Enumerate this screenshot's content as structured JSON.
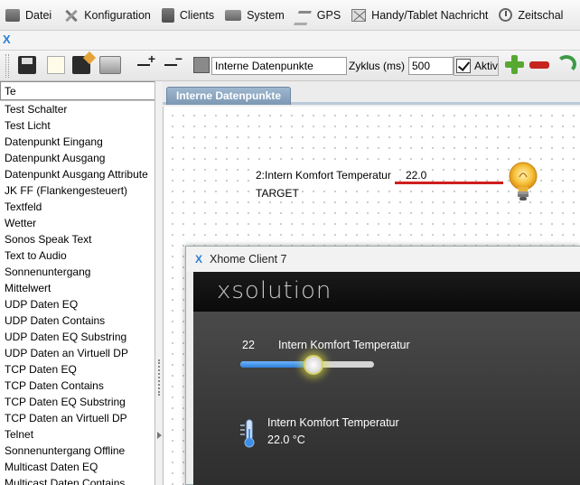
{
  "menu": {
    "items": [
      {
        "label": "Datei",
        "icon": "datei-icon"
      },
      {
        "label": "Konfiguration",
        "icon": "tools-icon"
      },
      {
        "label": "Clients",
        "icon": "clients-icon"
      },
      {
        "label": "System",
        "icon": "system-icon"
      },
      {
        "label": "GPS",
        "icon": "gps-icon"
      },
      {
        "label": "Handy/Tablet Nachricht",
        "icon": "message-icon"
      },
      {
        "label": "Zeitschal",
        "icon": "clock-icon"
      }
    ]
  },
  "logo": {
    "text": "X"
  },
  "toolbar": {
    "name_value": "Interne Datenpunkte",
    "zyklus_label": "Zyklus (ms)",
    "zyklus_value": "500",
    "aktiv_label": "Aktiv",
    "aktiv_checked": true
  },
  "sidebar": {
    "search_value": "Te",
    "items": [
      "Test Schalter",
      "Test Licht",
      "Datenpunkt Eingang",
      "Datenpunkt Ausgang",
      "Datenpunkt Ausgang Attribute",
      "JK FF (Flankengesteuert)",
      "Textfeld",
      "Wetter",
      "Sonos Speak Text",
      "Text to Audio",
      "Sonnenuntergang",
      "Mittelwert",
      "UDP Daten EQ",
      "UDP Daten Contains",
      "UDP Daten EQ Substring",
      "UDP Daten an Virtuell DP",
      "TCP Daten EQ",
      "TCP Daten Contains",
      "TCP Daten EQ Substring",
      "TCP Daten an Virtuell DP",
      "Telnet",
      "Sonnenuntergang Offline",
      "Multicast Daten EQ",
      "Multicast Daten Contains"
    ]
  },
  "tabs": [
    {
      "label": "Interne Datenpunkte"
    }
  ],
  "canvas": {
    "datapoint_label": "2:Intern Komfort Temperatur",
    "datapoint_value": "22.0",
    "datapoint_target": "TARGET",
    "line_color": "#d11d1d"
  },
  "client": {
    "title": "Xhome Client 7",
    "brand": "xsolution",
    "slider_value": "22",
    "slider_label": "Intern Komfort Temperatur",
    "slider_fraction": 0.55,
    "sensor_label": "Intern Komfort Temperatur",
    "sensor_value": "22.0 °C"
  }
}
